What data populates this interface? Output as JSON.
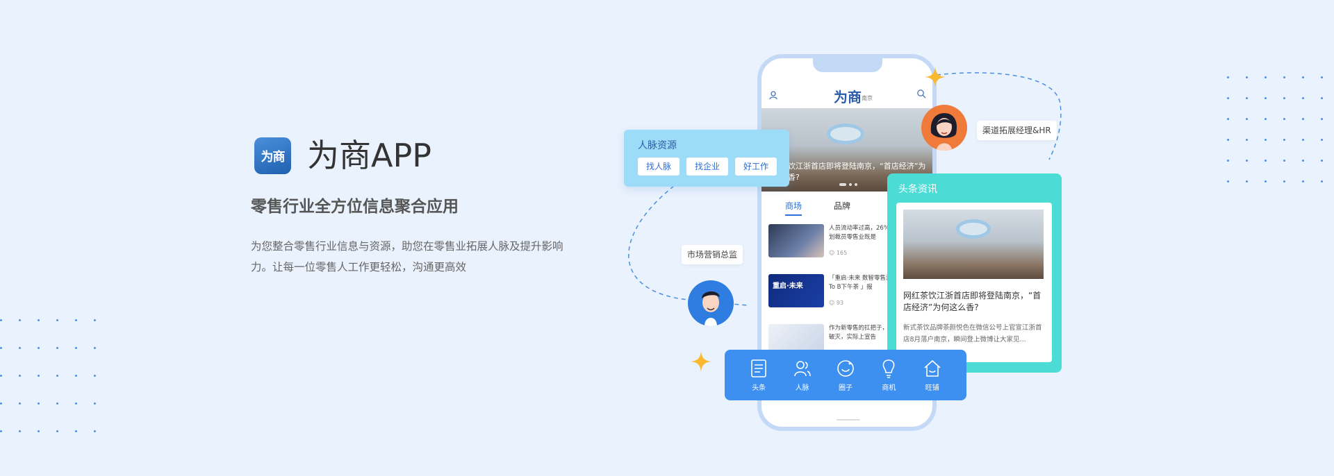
{
  "hero": {
    "logo_text": "为商",
    "title": "为商APP",
    "tagline": "零售行业全方位信息聚合应用",
    "description": "为您整合零售行业信息与资源，助您在零售业拓展人脉及提升影响力。让每一位零售人工作更轻松，沟通更高效"
  },
  "phone": {
    "brand": "为商",
    "city": "南京",
    "banner_text": "饮江浙首店即将登陆南京，“首店经济”为香?",
    "tabs": [
      "商场",
      "品牌"
    ],
    "feed": [
      {
        "text": "人员流动率过高，26%计划裁员零售业既是",
        "meta": "165"
      },
      {
        "text": "「重启·未来 数智零售消费To B下午茶 」报",
        "meta": "93"
      },
      {
        "text": "作为新零售的扛把子，话破灭，实际上宣告",
        "meta": ""
      }
    ],
    "feed_thumb_text": "重启·未来"
  },
  "people_card": {
    "title": "人脉资源",
    "buttons": [
      "找人脉",
      "找企业",
      "好工作"
    ]
  },
  "news_card": {
    "title": "头条资讯",
    "headline": "网红茶饮江浙首店即将登陆南京，“首店经济”为何这么香?",
    "body": "新式茶饮品牌茶颜悦色在微信公号上官宣江浙首店8月落户南京，瞬间登上微博让大家见..."
  },
  "bottom_nav": [
    {
      "label": "头条",
      "icon": "document-icon"
    },
    {
      "label": "人脉",
      "icon": "people-icon"
    },
    {
      "label": "圈子",
      "icon": "circle-icon"
    },
    {
      "label": "商机",
      "icon": "lightbulb-icon"
    },
    {
      "label": "旺铺",
      "icon": "shop-icon"
    }
  ],
  "labels": {
    "hr": "渠道拓展经理&HR",
    "marketing": "市场营销总监"
  },
  "colors": {
    "background": "#eaf2fd",
    "accent_blue": "#3d8ff0",
    "teal": "#4bdcd6",
    "light_blue": "#9ddcf8",
    "star": "#f9b931"
  }
}
